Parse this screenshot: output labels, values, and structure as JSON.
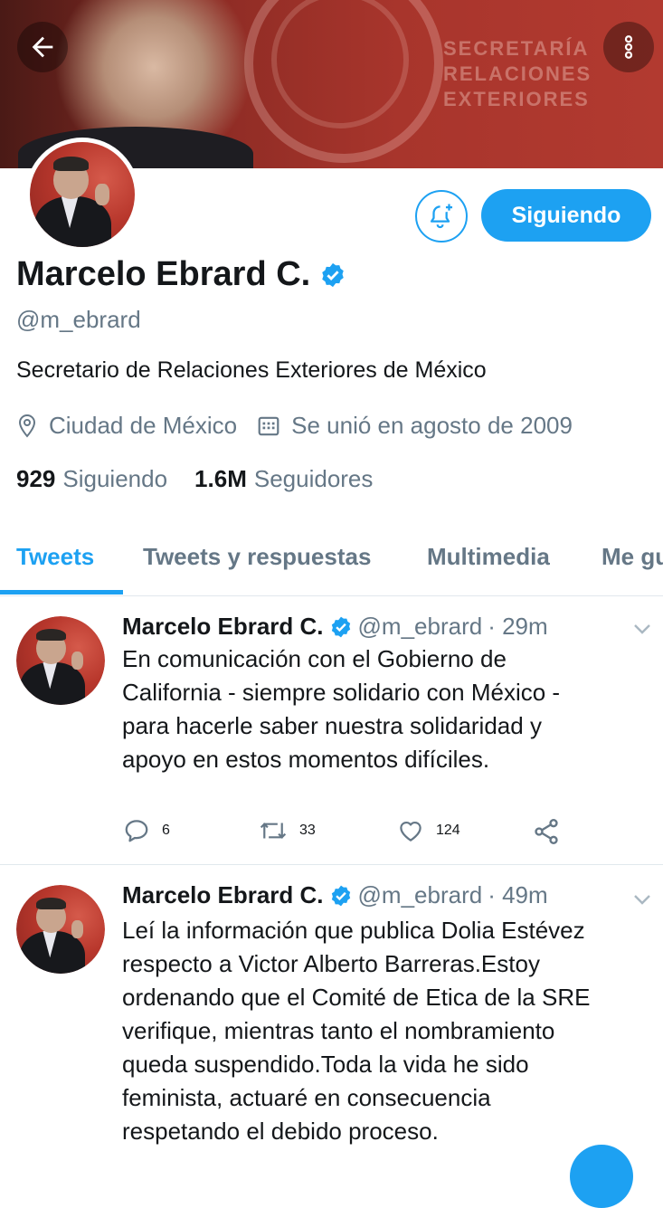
{
  "banner": {
    "text_lines": [
      "SECRETARÍA",
      "RELACIONES",
      "EXTERIORES"
    ]
  },
  "profile": {
    "name": "Marcelo Ebrard C.",
    "handle": "@m_ebrard",
    "bio": "Secretario de Relaciones Exteriores de México",
    "location": "Ciudad de México",
    "joined": "Se unió en agosto de 2009",
    "following_count": "929",
    "following_label": "Siguiendo",
    "followers_count": "1.6M",
    "followers_label": "Seguidores",
    "follow_button": "Siguiendo",
    "verified": true
  },
  "tabs": [
    {
      "label": "Tweets",
      "active": true
    },
    {
      "label": "Tweets y respuestas",
      "active": false
    },
    {
      "label": "Multimedia",
      "active": false
    },
    {
      "label": "Me gusta",
      "active": false
    }
  ],
  "tweets": [
    {
      "name": "Marcelo Ebrard C.",
      "handle": "@m_ebrard",
      "time": "· 29m",
      "lines": [
        "En comunicación con el Gobierno de",
        "California - siempre solidario con México -",
        "para hacerle saber nuestra solidaridad y",
        "apoyo en estos momentos difíciles."
      ],
      "replies": "6",
      "retweets": "33",
      "likes": "124"
    },
    {
      "name": "Marcelo Ebrard C.",
      "handle": "@m_ebrard",
      "time": "· 49m",
      "lines": [
        "Leí la información que publica Dolia Estévez",
        "respecto a Victor Alberto Barreras.Estoy",
        "ordenando que el Comité de Etica de la SRE",
        "verifique, mientras tanto el nombramiento",
        "queda suspendido.Toda la vida he sido",
        "feminista, actuaré en consecuencia",
        "respetando el debido proceso."
      ]
    }
  ],
  "icons": [
    "back-arrow-icon",
    "more-vertical-icon",
    "bell-plus-icon",
    "verified-badge-icon",
    "location-pin-icon",
    "calendar-icon",
    "reply-icon",
    "retweet-icon",
    "like-icon",
    "share-icon",
    "chevron-down-icon"
  ],
  "colors": {
    "accent": "#1da1f2",
    "text": "#14171a",
    "secondary": "#657786",
    "border": "#e1e8ed"
  }
}
